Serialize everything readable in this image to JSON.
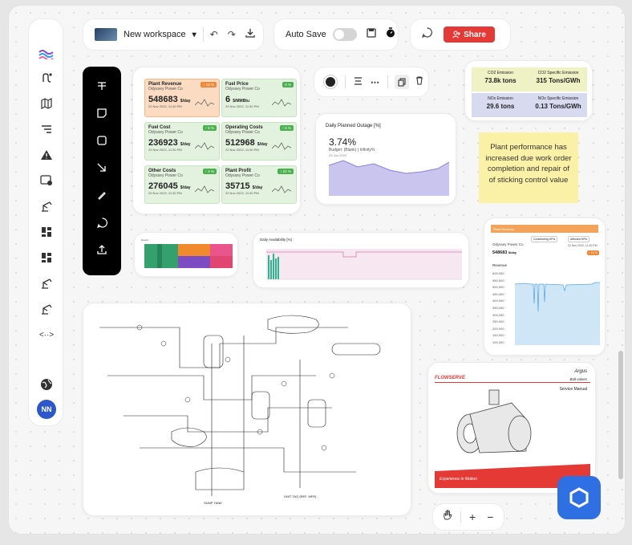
{
  "toolbar": {
    "workspace_name": "New workspace",
    "autosave_label": "Auto Save",
    "share_label": "Share"
  },
  "user": {
    "initials": "NN"
  },
  "kpis": [
    {
      "title": "Plant Revenue",
      "company": "Odyssey Power Co",
      "value": "548683",
      "unit": "$/day",
      "date": "22 Nov 2022, 11:30 PM",
      "badge": "↑ 12 %",
      "badge_color": "#f0883a",
      "bg": "#fbdcc2",
      "border": "#f3b98a"
    },
    {
      "title": "Fuel Price",
      "company": "Odyssey Power Co",
      "value": "6",
      "unit": "$/MMBtu",
      "date": "22 Nov 2022, 11:30 PM",
      "badge": "0 %",
      "badge_color": "#4caf50",
      "bg": "#e3f2de",
      "border": "#c7e3bf"
    },
    {
      "title": "Fuel Cost",
      "company": "Odyssey Power Co",
      "value": "236923",
      "unit": "$/day",
      "date": "22 Nov 2022, 11:30 PM",
      "badge": "↑ 5 %",
      "badge_color": "#4caf50",
      "bg": "#e3f2de",
      "border": "#c7e3bf"
    },
    {
      "title": "Operating Costs",
      "company": "Odyssey Power Co",
      "value": "512968",
      "unit": "$/day",
      "date": "22 Nov 2022, 11:30 PM",
      "badge": "↑ 6 %",
      "badge_color": "#4caf50",
      "bg": "#e3f2de",
      "border": "#c7e3bf"
    },
    {
      "title": "Other Costs",
      "company": "Odyssey Power Co",
      "value": "276045",
      "unit": "$/day",
      "date": "22 Nov 2022, 11:30 PM",
      "badge": "↑ 4 %",
      "badge_color": "#4caf50",
      "bg": "#e3f2de",
      "border": "#c7e3bf"
    },
    {
      "title": "Plant Profit",
      "company": "Odyssey Power Co",
      "value": "35715",
      "unit": "$/day",
      "date": "22 Nov 2022, 11:30 PM",
      "badge": "↑ 22 %",
      "badge_color": "#4caf50",
      "bg": "#e3f2de",
      "border": "#c7e3bf"
    }
  ],
  "emissions": [
    {
      "label": "CO2 Emission",
      "value": "73.8k tons",
      "bg": "#eef2c4"
    },
    {
      "label": "CO2 Specific Emission",
      "value": "315 Tons/GWh",
      "bg": "#eef2c4"
    },
    {
      "label": "NOx Emission",
      "value": "29.6 tons",
      "bg": "#d8daf0"
    },
    {
      "label": "NOx Specific Emission",
      "value": "0.13 Tons/GWh",
      "bg": "#d8daf0"
    }
  ],
  "outage": {
    "title": "Daily Planned Outage [%]",
    "value": "3.74%",
    "budget": "Budget: (Blank) | Infinity%",
    "date": "23 Jan 2023"
  },
  "note": {
    "text": "Plant performance has increased due work order completion and repair of of sticking control value",
    "bg": "#fbf1a6"
  },
  "availability": {
    "title": "Daily Availability [%]"
  },
  "revenue_panel": {
    "header": "Plant Revenue",
    "company": "Odyssey Power Co",
    "value": "548683",
    "unit": "$/day",
    "btn1": "Contributing KPIs",
    "btn2": "Affected KPIs",
    "chart_label": "Revenue",
    "badge": "↑ 12 %",
    "date": "22 Nov 2022, 11:30 PM",
    "yticks": [
      "600,000",
      "550,000",
      "500,000",
      "450,000",
      "400,000",
      "350,000",
      "300,000",
      "250,000",
      "200,000",
      "150,000",
      "100,000"
    ]
  },
  "manual": {
    "brand": "FLOWSERVE",
    "product": "Argus",
    "subtitle": "Ball valves",
    "doc_type": "Service Manual",
    "footer": "Experience In Motion"
  },
  "pid": {
    "bottom_label": "SUMP TANK",
    "note_label": "UNIT TAG (REF. MFR)"
  },
  "colors": {
    "accent": "#e53935",
    "brand_blue": "#2f6fe4",
    "avatar": "#2d58c9"
  },
  "icons": [
    "logo-icon",
    "route-icon",
    "map-icon",
    "list-icon",
    "warning-icon",
    "device-settings-icon",
    "asset-icon",
    "dashboard-icon",
    "dashboard-icon",
    "asset-icon",
    "asset-icon",
    "embed-icon",
    "globe-icon"
  ]
}
